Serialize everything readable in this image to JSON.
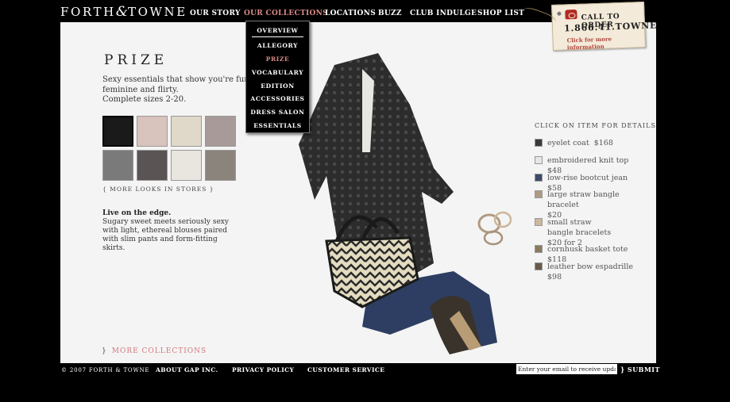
{
  "brand": {
    "logo_left": "FORTH",
    "logo_amp": "&",
    "logo_right": "TOWNE"
  },
  "nav": [
    {
      "label": "OUR STORY"
    },
    {
      "label": "OUR COLLECTIONS"
    },
    {
      "label": "LOCATIONS"
    },
    {
      "label": "BUZZ"
    },
    {
      "label": "CLUB INDULGE"
    },
    {
      "label": "SHOP LIST"
    }
  ],
  "call_tag": {
    "line1": "CALL TO ORDER",
    "line2": "1.866.41.TOWNE",
    "line3": "Click for more information"
  },
  "dropdown": [
    {
      "label": "OVERVIEW"
    },
    {
      "label": "ALLEGORY"
    },
    {
      "label": "PRIZE"
    },
    {
      "label": "VOCABULARY"
    },
    {
      "label": "EDITION"
    },
    {
      "label": "ACCESSORIES"
    },
    {
      "label": "DRESS SALON"
    },
    {
      "label": "ESSENTIALS"
    }
  ],
  "collection": {
    "title": "PRIZE",
    "description": "Sexy essentials that show you're fun, feminine and flirty.",
    "sizes": "Complete sizes 2-20.",
    "more_looks": "{ MORE LOOKS IN STORES }",
    "edge_title": "Live on the edge.",
    "edge_text": "Sugary sweet meets seriously sexy with light, ethereal blouses paired with slim pants and form-fitting skirts.",
    "more_collections": "MORE COLLECTIONS",
    "more_collections_brace": "}"
  },
  "thumb_colors": [
    "#1a1a1a",
    "#d8c3bd",
    "#e0d8c8",
    "#a89a98",
    "#7a7a7a",
    "#5a5454",
    "#e9e6e0",
    "#8a847c"
  ],
  "items": {
    "header": "CLICK ON ITEM FOR DETAILS",
    "list": [
      {
        "name": "eyelet coat",
        "price": "$168",
        "color": "#3a3a3a"
      },
      {
        "name": "embroidered knit top",
        "price": "$48",
        "color": "#e8e6e2"
      },
      {
        "name": "low-rise bootcut jean",
        "price": "$58",
        "color": "#3d4a6a"
      },
      {
        "name": "large straw bangle bracelet",
        "price": "$20",
        "color": "#b09a80"
      },
      {
        "name": "small straw bangle bracelets",
        "price": "$20 for 2",
        "color": "#cdb79a"
      },
      {
        "name": "cornhusk basket tote",
        "price": "$118",
        "color": "#8a7a60"
      },
      {
        "name": "leather bow espadrille",
        "price": "$98",
        "color": "#6a5a4a"
      }
    ]
  },
  "footer": {
    "copyright": "© 2007 FORTH & TOWNE",
    "about": "ABOUT GAP INC.",
    "privacy": "PRIVACY POLICY",
    "service": "CUSTOMER SERVICE",
    "email_placeholder": "Enter your email to receive updates",
    "submit": "} SUBMIT"
  }
}
